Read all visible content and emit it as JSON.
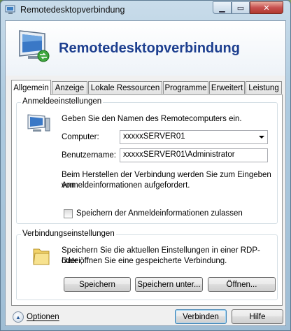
{
  "window": {
    "title": "Remotedesktopverbindung"
  },
  "banner": {
    "title": "Remotedesktopverbindung"
  },
  "tabs": [
    {
      "label": "Allgemein"
    },
    {
      "label": "Anzeige"
    },
    {
      "label": "Lokale Ressourcen"
    },
    {
      "label": "Programme"
    },
    {
      "label": "Erweitert"
    },
    {
      "label": "Leistung"
    }
  ],
  "logon": {
    "group_label": "Anmeldeeinstellungen",
    "instruction": "Geben Sie den Namen des Remotecomputers ein.",
    "computer_label": "Computer:",
    "computer_value": "xxxxxSERVER01",
    "username_label": "Benutzername:",
    "username_value": "xxxxxSERVER01\\Administrator",
    "info_line1": "Beim Herstellen der Verbindung werden Sie zum Eingeben von",
    "info_line2": "Anmeldeinformationen aufgefordert.",
    "save_credentials_label": "Speichern der Anmeldeinformationen zulassen",
    "save_credentials_checked": false
  },
  "connection": {
    "group_label": "Verbindungseinstellungen",
    "text_line1": "Speichern Sie die aktuellen Einstellungen in einer RDP-Datei,",
    "text_line2": "oder öffnen Sie eine gespeicherte Verbindung.",
    "save_label": "Speichern",
    "save_as_label": "Speichern unter...",
    "open_label": "Öffnen..."
  },
  "footer": {
    "options_label": "Optionen",
    "connect_label": "Verbinden",
    "help_label": "Hilfe"
  },
  "colors": {
    "banner_title": "#1d3f8f",
    "close_button": "#c75050"
  }
}
